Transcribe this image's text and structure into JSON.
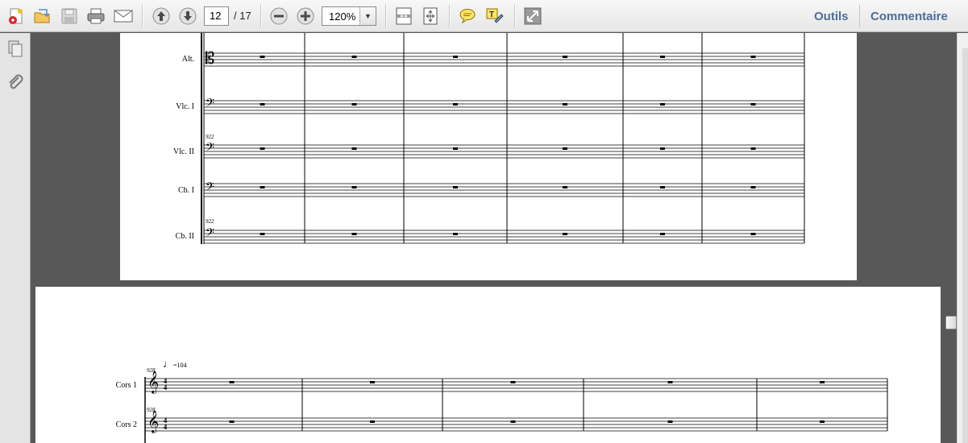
{
  "toolbar": {
    "page_current": "12",
    "page_total": "/ 17",
    "zoom": "120%",
    "zoom_arrow": "▼",
    "tools_label": "Outils",
    "comment_label": "Commentaire"
  },
  "score_top": {
    "instruments": [
      "Alt.",
      "Vlc. I",
      "Vlc. II",
      "Cb. I",
      "Cb. II"
    ],
    "measure_numbers": [
      "922",
      "922"
    ]
  },
  "score_bottom": {
    "instruments": [
      "Cors 1",
      "Cors 2"
    ],
    "tempo": "=104",
    "measure_numbers": [
      "928",
      "928"
    ],
    "time_signature": [
      "4",
      "4"
    ]
  }
}
